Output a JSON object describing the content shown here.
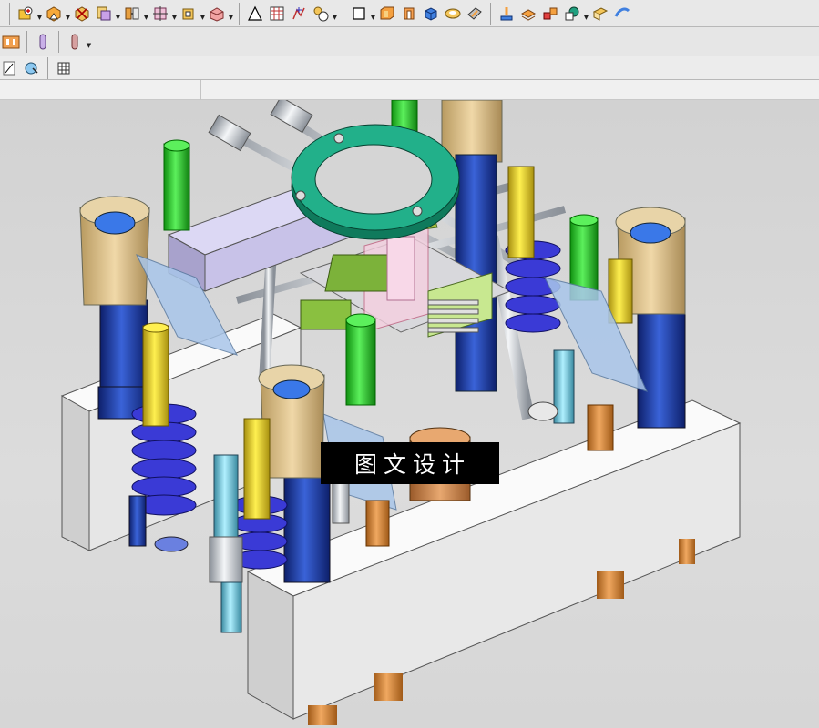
{
  "toolbars": {
    "row1_icons": [
      "add-component-icon",
      "pattern-component-icon",
      "mirror-assembly-icon",
      "wave-link-icon",
      "assembly-constraints-icon",
      "move-component-icon",
      "assembly-navigator-icon",
      "exploded-view-icon",
      "triangle-sketch-icon",
      "table-grid-icon",
      "point-set-icon",
      "gear-assembly-icon",
      "rectangle-icon",
      "block-feature-icon",
      "cylinder-feature-icon",
      "cube-feature-icon",
      "boolean-unite-icon",
      "edge-blend-icon",
      "mold-wizard-icon",
      "mold-base-icon",
      "parting-tools-icon",
      "insert-pocket-icon",
      "cavity-layout-icon",
      "view-orient-icon"
    ],
    "row2_icons": [
      "slot-feature-icon",
      "pin-feature-icon",
      "lifter-feature-icon"
    ],
    "row3_icons": [
      "select-filter-icon",
      "snap-point-icon",
      "grid-icon"
    ]
  },
  "viewport": {
    "background": "#d5d5d5",
    "watermark": "图文设计"
  },
  "colors": {
    "plate": "#e9e9e9",
    "guide_bush": "#d9c08d",
    "pillar": "#1f3fa6",
    "spring": "#3a3ad6",
    "ring": "#1f9a7a",
    "green_part": "#2bd12b",
    "yellow_pin": "#e8d41f",
    "orange_pin": "#d98a3a",
    "lilac_block": "#c8c2e8",
    "glass_block": "#a9c6ea"
  }
}
